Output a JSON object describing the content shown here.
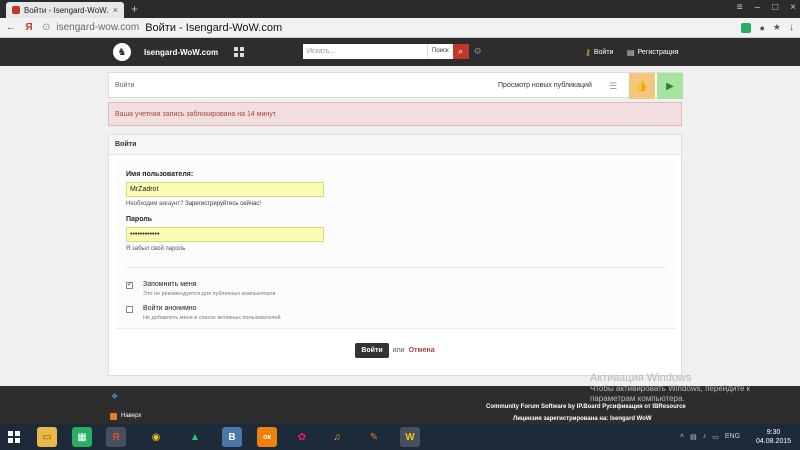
{
  "browser": {
    "tab_title": "Войти - Isengard-WoW.com",
    "new_tab_glyph": "+",
    "url_host": "isengard-wow.com",
    "url_title": "Войти - Isengard-WoW.com",
    "yandex_glyph": "Я"
  },
  "header": {
    "site_name": "Isengard-WoW.com",
    "search_placeholder": "Искать...",
    "search_scope": "Поиск",
    "login_label": "Войти",
    "register_label": "Регистрация"
  },
  "toolbar": {
    "breadcrumb": "Войти",
    "new_posts": "Просмотр новых публикаций"
  },
  "alert": {
    "text": "Ваша учетная запись заблокирована на 14 минут"
  },
  "login": {
    "title": "Войти",
    "username_label": "Имя пользователя:",
    "username_value": "MrZadrot",
    "need_account_text": "Необходим аккаунт?",
    "register_link": "Зарегистрируйтесь сейчас!",
    "password_label": "Пароль",
    "password_value": "••••••••••••",
    "forgot_link": "Я забыл свой пароль",
    "remember_label": "Запомнить меня",
    "remember_note": "Это не рекомендуется для публичных компьютеров",
    "remember_checked": true,
    "anon_label": "Войти анонимно",
    "anon_note": "Не добавлять меня в список активных пользователей",
    "anon_checked": false,
    "submit_label": "Войти",
    "or_text": "или",
    "cancel_label": "Отмена"
  },
  "footer": {
    "top_link": "Наверх",
    "credit": "Community Forum Software by IP.Board Русификация от IBResource",
    "license": "Лицензия зарегистрирована на: Isengard WoW"
  },
  "watermark": {
    "title": "Активация Windows",
    "line1": "Чтобы активировать Windows, перейдите к",
    "line2": "параметрам компьютера."
  },
  "taskbar": {
    "lang": "ENG",
    "time": "9:30",
    "date": "04.08.2015",
    "yandex_glyph": "Я",
    "vk_glyph": "В",
    "ok_glyph": "ок"
  },
  "colors": {
    "header_bg": "#2d2d2d",
    "search_button": "#c0392b",
    "alert_bg": "#f2dede",
    "alert_text": "#a94442",
    "input_bg": "#fbfbb3"
  }
}
